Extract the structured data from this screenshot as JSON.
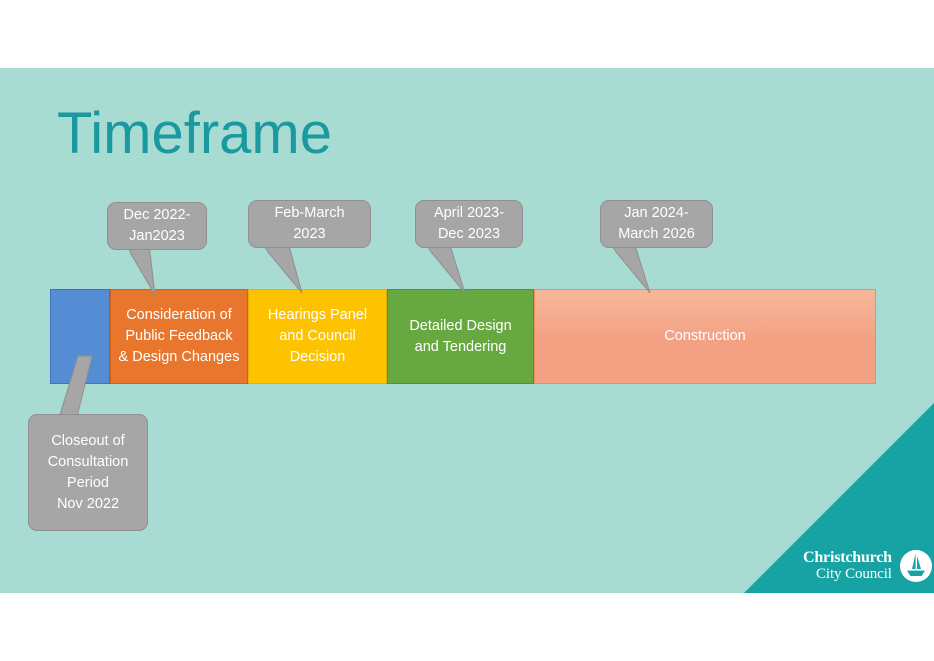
{
  "slide": {
    "title": "Timeframe",
    "background_color": "#a8dcd2",
    "title_color": "#1a9aa0",
    "accent_color": "#15a0a0"
  },
  "timeline": {
    "phases": [
      {
        "label": "",
        "color": "#548dd4",
        "name": "phase-closeout"
      },
      {
        "label": "Consideration of\nPublic Feedback\n& Design Changes",
        "color": "#e8762c",
        "name": "phase-consideration"
      },
      {
        "label": "Hearings Panel\nand Council\nDecision",
        "color": "#fdc300",
        "name": "phase-hearings"
      },
      {
        "label": "Detailed Design\nand Tendering",
        "color": "#67a940",
        "name": "phase-design"
      },
      {
        "label": "Construction",
        "color": "#f4a183",
        "name": "phase-construction"
      }
    ]
  },
  "callouts": [
    {
      "id": "callout-dec",
      "text": "Dec 2022-\nJan2023"
    },
    {
      "id": "callout-feb",
      "text": "Feb-March\n2023"
    },
    {
      "id": "callout-april",
      "text": "April 2023-\nDec 2023"
    },
    {
      "id": "callout-jan",
      "text": "Jan 2024-\nMarch 2026"
    },
    {
      "id": "callout-closeout",
      "text": "Closeout of\nConsultation\nPeriod\nNov 2022"
    }
  ],
  "logo": {
    "line1": "Christchurch",
    "line2": "City Council",
    "mark": "sailing-boat-emblem-icon"
  }
}
